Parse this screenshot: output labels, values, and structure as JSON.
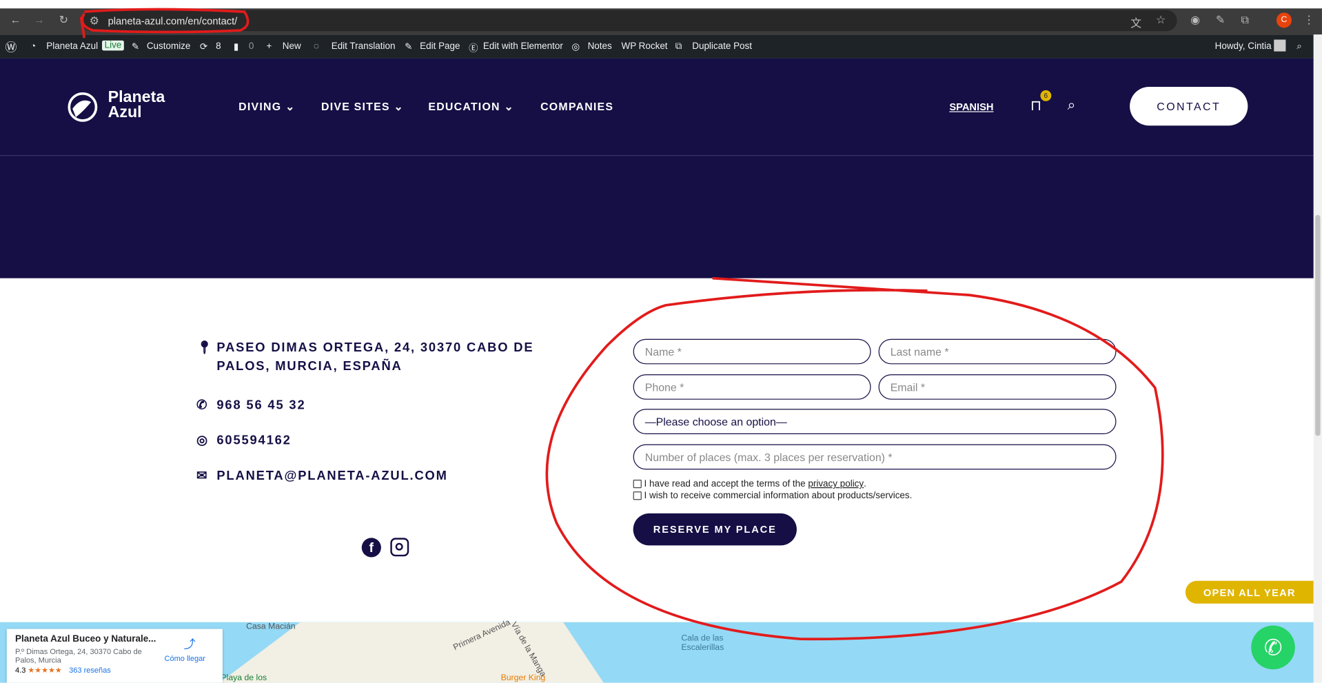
{
  "browser": {
    "url": "planeta-azul.com/en/contact/",
    "profile_initial": "C"
  },
  "admin_bar": {
    "site": "Planeta Azul",
    "live": "Live",
    "customize": "Customize",
    "updates": "8",
    "comments": "0",
    "new": "New",
    "edit_translation": "Edit Translation",
    "edit_page": "Edit Page",
    "elementor": "Edit with Elementor",
    "notes": "Notes",
    "wp_rocket": "WP Rocket",
    "duplicate": "Duplicate Post",
    "howdy": "Howdy, Cintia"
  },
  "header": {
    "logo_line1": "Planeta",
    "logo_line2": "Azul",
    "nav": [
      "DIVING",
      "DIVE SITES",
      "EDUCATION",
      "COMPANIES"
    ],
    "language": "SPANISH",
    "cart_count": "6",
    "contact": "CONTACT"
  },
  "contact_info": {
    "address": "PASEO DIMAS ORTEGA, 24, 30370 CABO DE PALOS, MURCIA, ESPAÑA",
    "phone": "968 56 45 32",
    "whatsapp": "605594162",
    "email": "PLANETA@PLANETA-AZUL.COM"
  },
  "form": {
    "name": "Name *",
    "last_name": "Last name *",
    "phone": "Phone *",
    "email": "Email *",
    "select": "—Please choose an option—",
    "places": "Number of places (max. 3 places per reservation) *",
    "privacy_pre": "I have read and accept the terms of the ",
    "privacy_link": "privacy policy",
    "privacy_post": ".",
    "commercial": "I wish to receive commercial information about products/services.",
    "submit": "RESERVE MY PLACE"
  },
  "badge": {
    "open": "OPEN ALL YEAR"
  },
  "map": {
    "place": "Planeta Azul Buceo y Naturale...",
    "address": "P.º Dimas Ortega, 24, 30370 Cabo de Palos, Murcia",
    "rating": "4.3",
    "stars": "★★★★★",
    "reviews": "363 reseñas",
    "directions": "Cómo llegar",
    "labels": [
      "Casa Macián",
      "Primera Avenida",
      "Vía de la Manga",
      "Cala de las Escalerillas",
      "Burger King",
      "Playa de los"
    ]
  }
}
